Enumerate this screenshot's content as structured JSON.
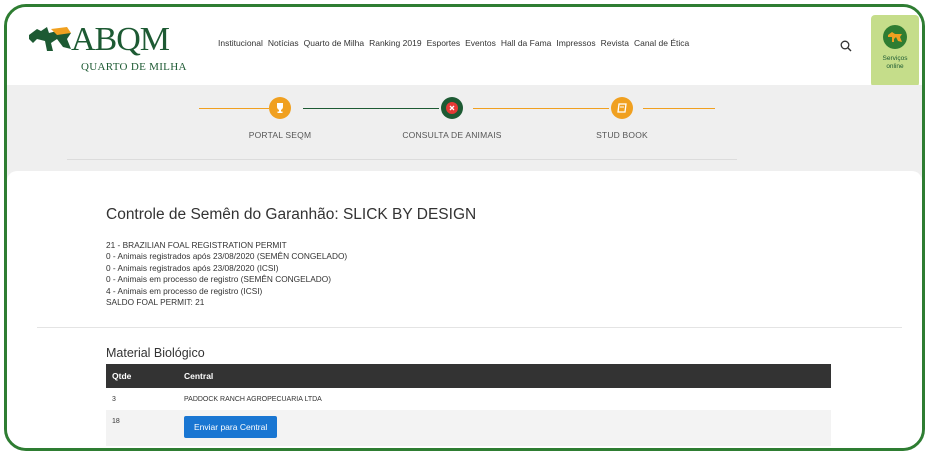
{
  "logo": {
    "abqm": "ABQM",
    "subtitle": "QUARTO DE MILHA"
  },
  "nav": {
    "items": [
      "Institucional",
      "Notícias",
      "Quarto de Milha",
      "Ranking 2019",
      "Esportes",
      "Eventos",
      "Hall da Fama",
      "Impressos",
      "Revista",
      "Canal de Ética"
    ]
  },
  "search": {
    "icon": "search-icon"
  },
  "services": {
    "icon": "horse-icon",
    "label_line1": "Serviços",
    "label_line2": "online"
  },
  "steps": [
    {
      "label": "PORTAL SEQM",
      "icon": "trophy-icon",
      "color": "#f0a020"
    },
    {
      "label": "CONSULTA DE ANIMAIS",
      "icon": "close-icon",
      "color": "#1d5a33"
    },
    {
      "label": "STUD BOOK",
      "icon": "book-icon",
      "color": "#f0a020"
    }
  ],
  "content": {
    "title": "Controle de Semên do Garanhão: SLICK BY DESIGN",
    "info": [
      "21 - BRAZILIAN FOAL REGISTRATION PERMIT",
      "0 - Animais registrados após 23/08/2020 (SEMÊN CONGELADO)",
      "0 - Animais registrados após 23/08/2020 (ICSI)",
      "0 - Animais em processo de registro (SEMÊN CONGELADO)",
      "4 - Animais em processo de registro (ICSI)",
      "SALDO FOAL PERMIT: 21"
    ],
    "section_title": "Material Biológico",
    "table": {
      "headers": [
        "Qtde",
        "Central"
      ],
      "rows": [
        {
          "qtde": "3",
          "central": "PADDOCK RANCH AGROPECUARIA LTDA"
        },
        {
          "qtde": "18",
          "button": "Enviar para Central"
        }
      ]
    }
  },
  "colors": {
    "brand_green": "#1d5a33",
    "accent_orange": "#f0a020",
    "button_blue": "#1976d2",
    "frame_green": "#2e7d32"
  }
}
